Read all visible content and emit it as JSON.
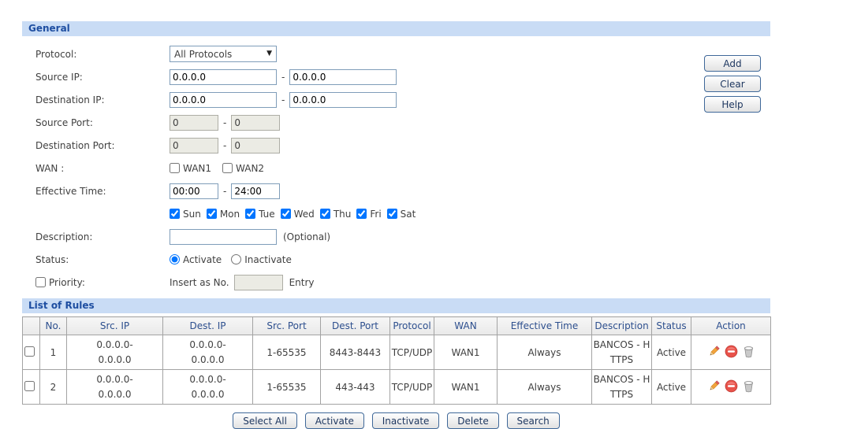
{
  "separator": "-",
  "colors": {
    "band-bg": "#c9dcf5",
    "band-text": "#1e4ea1",
    "label-text": "#404040",
    "input-border": "#7f9db9",
    "disabled-bg": "#ebebe4",
    "disabled-border": "#adada5",
    "table-border": "#a3a3a3",
    "header-text": "#2d4f8e",
    "cell-text": "#404040",
    "button-border": "#3f6899",
    "button-text": "#1c355e"
  },
  "general": {
    "title": "General",
    "protocol": {
      "label": "Protocol:",
      "value": "All Protocols"
    },
    "source_ip": {
      "label": "Source IP:",
      "from": "0.0.0.0",
      "to": "0.0.0.0"
    },
    "destination_ip": {
      "label": "Destination IP:",
      "from": "0.0.0.0",
      "to": "0.0.0.0"
    },
    "source_port": {
      "label": "Source Port:",
      "from": "0",
      "to": "0"
    },
    "destination_port": {
      "label": "Destination Port:",
      "from": "0",
      "to": "0"
    },
    "wan": {
      "label": "WAN :",
      "options": [
        "WAN1",
        "WAN2"
      ]
    },
    "effective_time": {
      "label": "Effective Time:",
      "from": "00:00",
      "to": "24:00"
    },
    "days": [
      "Sun",
      "Mon",
      "Tue",
      "Wed",
      "Thu",
      "Fri",
      "Sat"
    ],
    "description": {
      "label": "Description:",
      "value": "",
      "hint": "(Optional)"
    },
    "status": {
      "label": "Status:",
      "activate": "Activate",
      "inactivate": "Inactivate",
      "selected": "Activate"
    },
    "priority": {
      "label": "Priority:",
      "prefix": "Insert as No.",
      "value": "",
      "suffix": "Entry"
    },
    "side_buttons": [
      "Add",
      "Clear",
      "Help"
    ]
  },
  "rules": {
    "title": "List of Rules",
    "columns": [
      "No.",
      "Src. IP",
      "Dest. IP",
      "Src. Port",
      "Dest. Port",
      "Protocol",
      "WAN",
      "Effective Time",
      "Description",
      "Status",
      "Action"
    ],
    "action_icons": [
      "edit",
      "block",
      "delete"
    ],
    "rows": [
      {
        "no": "1",
        "src_ip": "0.0.0.0-\n0.0.0.0",
        "dest_ip": "0.0.0.0-\n0.0.0.0",
        "src_port": "1-65535",
        "dest_port": "8443-8443",
        "protocol": "TCP/UDP",
        "wan": "WAN1",
        "effective_time": "Always",
        "description": "BANCOS - H\nTTPS",
        "status": "Active"
      },
      {
        "no": "2",
        "src_ip": "0.0.0.0-\n0.0.0.0",
        "dest_ip": "0.0.0.0-\n0.0.0.0",
        "src_port": "1-65535",
        "dest_port": "443-443",
        "protocol": "TCP/UDP",
        "wan": "WAN1",
        "effective_time": "Always",
        "description": "BANCOS - H\nTTPS",
        "status": "Active"
      }
    ]
  },
  "footer_buttons": [
    "Select All",
    "Activate",
    "Inactivate",
    "Delete",
    "Search"
  ]
}
